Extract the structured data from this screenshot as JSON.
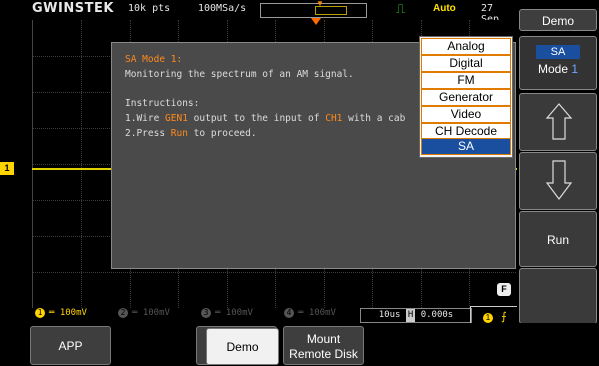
{
  "topbar": {
    "brand": "GWINSTEK",
    "record_length": "10k pts",
    "sample_rate": "100MSa/s",
    "trigger_status": "Auto",
    "date": "27 Sep"
  },
  "dialog": {
    "title": "SA Mode 1:",
    "description": "Monitoring the spectrum of an AM signal.",
    "instructions_label": "Instructions:",
    "step1_pre": "1.Wire ",
    "step1_highlight1": "GEN1",
    "step1_mid": " output to the input of ",
    "step1_highlight2": "CH1",
    "step1_post": " with a cab",
    "step2_pre": "2.Press ",
    "step2_highlight": "Run",
    "step2_post": " to proceed."
  },
  "submenu": {
    "items": [
      "Analog",
      "Digital",
      "FM",
      "Generator",
      "Video",
      "CH Decode",
      "SA"
    ],
    "selected": "SA"
  },
  "channels": [
    {
      "num": "1",
      "scale": "100mV",
      "active": true
    },
    {
      "num": "2",
      "scale": "100mV",
      "active": false
    },
    {
      "num": "3",
      "scale": "100mV",
      "active": false
    },
    {
      "num": "4",
      "scale": "100mV",
      "active": false
    }
  ],
  "timebase": {
    "scale": "10us",
    "h_icon": "H",
    "position": "0.000s"
  },
  "trigger": {
    "channel": "1"
  },
  "ch1_marker": "1",
  "f_key": "F",
  "right_panel": {
    "title": "Demo",
    "mode_label": "SA",
    "mode_prefix": "Mode",
    "mode_number": "1",
    "up_icon": "arrow-up-icon",
    "down_icon": "arrow-down-icon",
    "run_label": "Run"
  },
  "bottom": {
    "app_label": "APP",
    "demo_label": "Demo",
    "mount_label_1": "Mount",
    "mount_label_2": "Remote Disk"
  },
  "colors": {
    "ch1": "#ffd400",
    "highlight": "#ff8a1c",
    "selected_menu": "#1a4fa0",
    "trigger_auto": "#ffe000"
  }
}
